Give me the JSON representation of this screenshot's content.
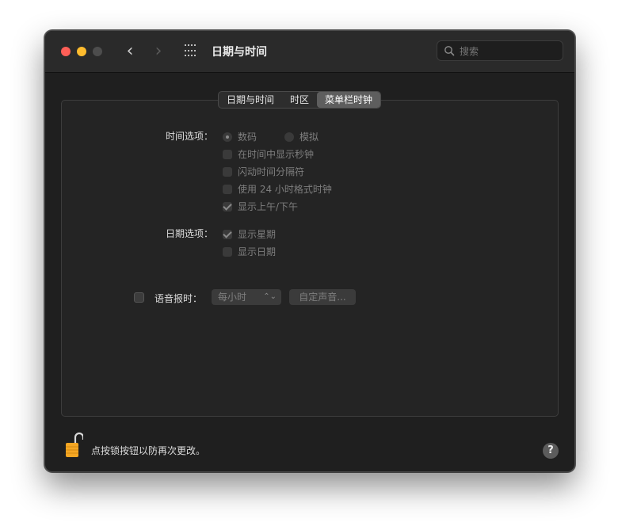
{
  "window": {
    "title": "日期与时间"
  },
  "search": {
    "placeholder": "搜索"
  },
  "tabs": [
    {
      "label": "日期与时间"
    },
    {
      "label": "时区"
    },
    {
      "label": "菜单栏时钟",
      "active": true
    }
  ],
  "time_options": {
    "label": "时间选项：",
    "radio_digital": "数码",
    "radio_analog": "模拟",
    "show_seconds": "在时间中显示秒钟",
    "flash_separators": "闪动时间分隔符",
    "use_24h": "使用 24 小时格式时钟",
    "show_am_pm": "显示上午/下午"
  },
  "date_options": {
    "label": "日期选项：",
    "show_weekday": "显示星期",
    "show_date": "显示日期"
  },
  "announce": {
    "label": "语音报时：",
    "interval": "每小时",
    "custom_voice": "自定声音..."
  },
  "footer": {
    "lock_text": "点按锁按钮以防再次更改。",
    "help": "?"
  },
  "colors": {
    "close": "#fe5f57",
    "minimize": "#febc2e",
    "lock": "#f5a623"
  }
}
